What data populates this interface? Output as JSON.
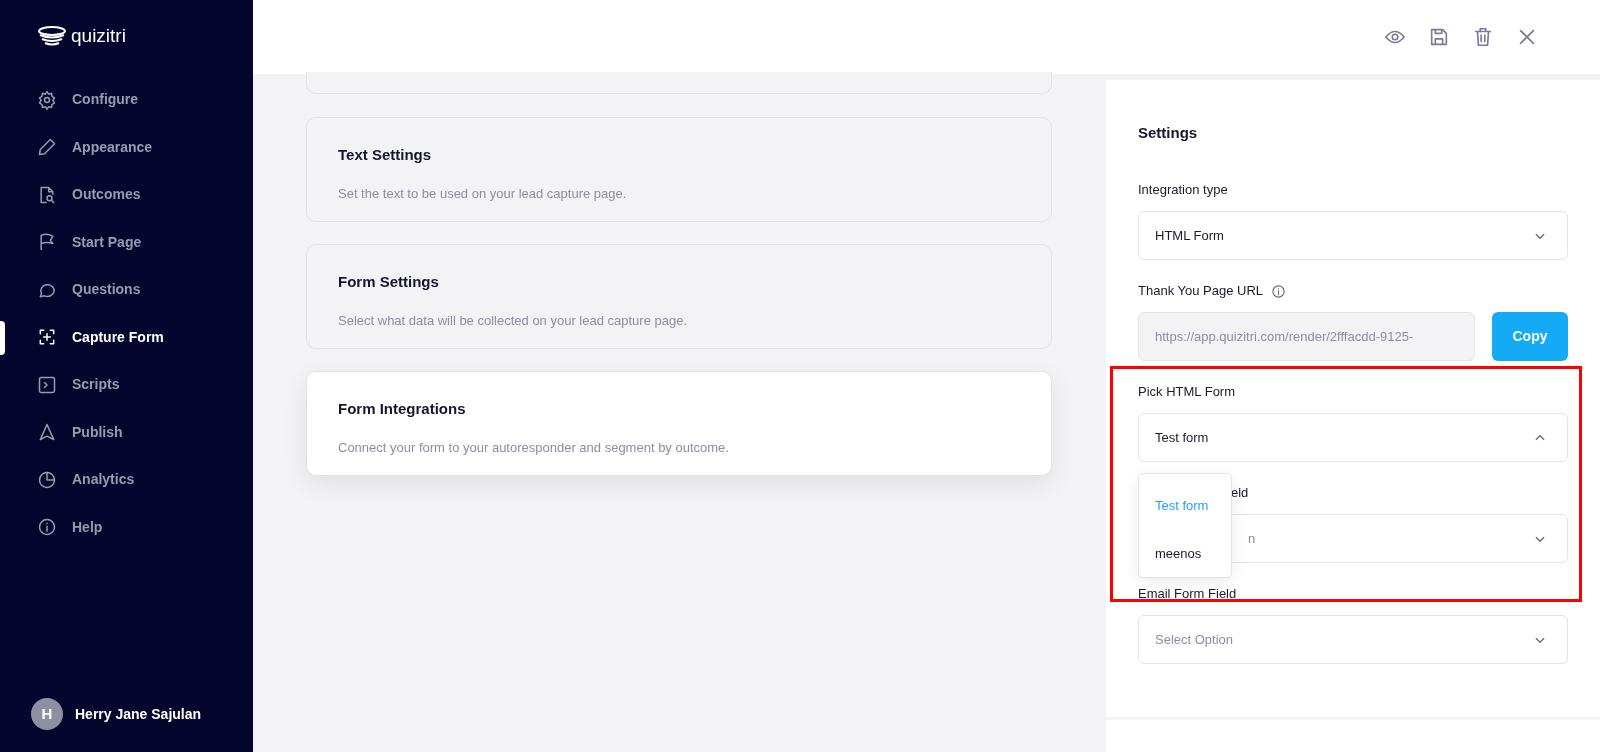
{
  "app": {
    "logo": "quizitri"
  },
  "sidebar": {
    "items": [
      {
        "label": "Configure",
        "selected": false
      },
      {
        "label": "Appearance",
        "selected": false
      },
      {
        "label": "Outcomes",
        "selected": false
      },
      {
        "label": "Start Page",
        "selected": false
      },
      {
        "label": "Questions",
        "selected": false
      },
      {
        "label": "Capture Form",
        "selected": true
      },
      {
        "label": "Scripts",
        "selected": false
      },
      {
        "label": "Publish",
        "selected": false
      },
      {
        "label": "Analytics",
        "selected": false
      },
      {
        "label": "Help",
        "selected": false
      }
    ],
    "user": {
      "initial": "H",
      "name": "Herry Jane Sajulan"
    }
  },
  "cards": [
    {
      "title": "Text Settings",
      "description": "Set the text to be used on your lead capture page.",
      "selected": false
    },
    {
      "title": "Form Settings",
      "description": "Select what data will be collected on your lead capture page.",
      "selected": false
    },
    {
      "title": "Form Integrations",
      "description": "Connect your form to your autoresponder and segment by outcome.",
      "selected": true
    }
  ],
  "settings": {
    "title": "Settings",
    "fields": [
      {
        "kind": "select",
        "label": "Integration type",
        "value": "HTML Form",
        "expanded": false
      },
      {
        "kind": "url",
        "label": "Thank You Page URL",
        "value": "https://app.quizitri.com/render/2fffacdd-9125-",
        "button": "Copy"
      },
      {
        "kind": "select",
        "label": "Pick HTML Form",
        "value": "Test form",
        "expanded": true,
        "options": [
          {
            "label": "Test form",
            "selected": true
          },
          {
            "label": "meenos",
            "selected": false
          }
        ]
      },
      {
        "kind": "select",
        "label": "eld",
        "placeholder": "n",
        "expanded": false
      },
      {
        "kind": "select",
        "label": "Email Form Field",
        "placeholder": "Select Option",
        "expanded": false
      }
    ]
  }
}
